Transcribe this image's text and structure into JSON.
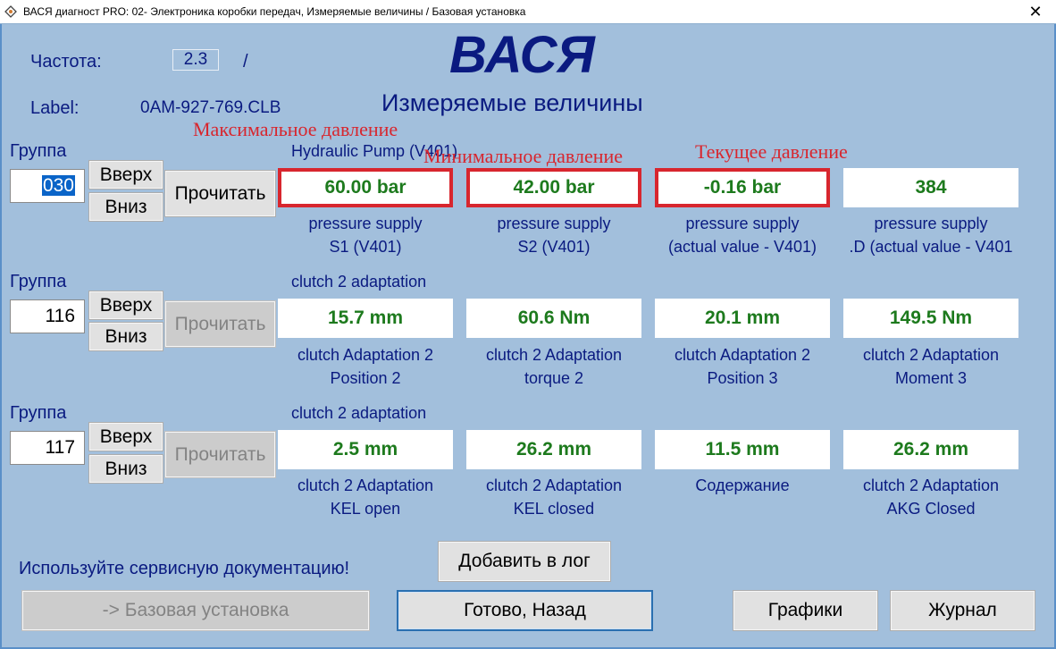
{
  "window": {
    "title": "ВАСЯ диагност PRO: 02- Электроника коробки передач,  Измеряемые величины / Базовая установка",
    "close_glyph": "✕"
  },
  "header": {
    "freq_label": "Частота:",
    "freq_value": "2.3",
    "freq_sep": "/",
    "logo": "ВАСЯ",
    "label_label": "Label:",
    "label_value": "0AM-927-769.CLB",
    "subtitle": "Измеряемые величины"
  },
  "annotations": {
    "max_pressure": "Максимальное давление",
    "min_pressure": "Минимальное давление",
    "current_pressure": "Текущее давление",
    "color": "#d8262e"
  },
  "groups": [
    {
      "label": "Группа",
      "number": "030",
      "up": "Вверх",
      "down": "Вниз",
      "read": "Прочитать",
      "read_enabled": true,
      "title": "Hydraulic Pump (V401)",
      "values": [
        {
          "value": "60.00 bar",
          "desc1": "pressure supply",
          "desc2": "S1 (V401)",
          "highlighted": true
        },
        {
          "value": "42.00 bar",
          "desc1": "pressure supply",
          "desc2": "S2 (V401)",
          "highlighted": true
        },
        {
          "value": "-0.16 bar",
          "desc1": "pressure supply",
          "desc2": "(actual value - V401)",
          "highlighted": true
        },
        {
          "value": "384",
          "desc1": "pressure supply",
          "desc2": ".D (actual value - V401",
          "highlighted": false
        }
      ]
    },
    {
      "label": "Группа",
      "number": "116",
      "up": "Вверх",
      "down": "Вниз",
      "read": "Прочитать",
      "read_enabled": false,
      "title": "clutch 2 adaptation",
      "values": [
        {
          "value": "15.7 mm",
          "desc1": "clutch Adaptation 2",
          "desc2": "Position 2"
        },
        {
          "value": "60.6 Nm",
          "desc1": "clutch 2 Adaptation",
          "desc2": "torque 2"
        },
        {
          "value": "20.1 mm",
          "desc1": "clutch Adaptation 2",
          "desc2": "Position 3"
        },
        {
          "value": "149.5 Nm",
          "desc1": "clutch 2 Adaptation",
          "desc2": "Moment 3"
        }
      ]
    },
    {
      "label": "Группа",
      "number": "117",
      "up": "Вверх",
      "down": "Вниз",
      "read": "Прочитать",
      "read_enabled": false,
      "title": "clutch 2 adaptation",
      "values": [
        {
          "value": "2.5 mm",
          "desc1": "clutch 2 Adaptation",
          "desc2": "KEL open"
        },
        {
          "value": "26.2 mm",
          "desc1": "clutch 2 Adaptation",
          "desc2": "KEL closed"
        },
        {
          "value": "11.5 mm",
          "desc1": "Содержание",
          "desc2": ""
        },
        {
          "value": "26.2 mm",
          "desc1": "clutch 2 Adaptation",
          "desc2": "AKG Closed"
        }
      ]
    }
  ],
  "footer": {
    "notice": "Используйте сервисную документацию!",
    "add_to_log": "Добавить в лог",
    "basic_setting": "-> Базовая установка",
    "done_back": "Готово, Назад",
    "charts": "Графики",
    "journal": "Журнал"
  },
  "colors": {
    "background": "#a2bfdc",
    "text_navy": "#0a1a80",
    "value_green": "#1d7a1d",
    "highlight_red": "#d8262e"
  }
}
